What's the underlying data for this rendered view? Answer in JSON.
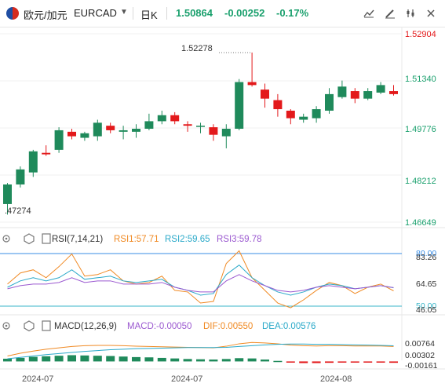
{
  "toolbar": {
    "symbol_cn": "欧元/加元",
    "symbol": "EURCAD",
    "period": "日K",
    "price": "1.50864",
    "change": "-0.00252",
    "change_pct": "-0.17%",
    "quote_color": "#1aa06d",
    "icons": [
      "chart-style-icon",
      "draw-icon",
      "settings-icon",
      "indicator-icon"
    ]
  },
  "main_chart": {
    "price_labels": [
      "1.52904",
      "1.51340",
      "1.49776",
      "1.48212",
      "1.46649"
    ],
    "high_label": "1.52278",
    "low_label": ".47274",
    "last_price_label": "1.51340",
    "up_color": "#1f8a5b",
    "down_color": "#e3191b",
    "price_label_color": "#e3191b",
    "price_label_color_2": "#1aa06d"
  },
  "rsi": {
    "title": "RSI(7,14,21)",
    "rsi1": "RSI1:57.71",
    "rsi2": "RSI2:59.65",
    "rsi3": "RSI3:59.78",
    "rsi1_color": "#f08a24",
    "rsi2_color": "#2aa9c9",
    "rsi3_color": "#9b59d0",
    "axis_labels": [
      "80.00",
      "83.26",
      "64.65",
      "50.00",
      "46.05"
    ]
  },
  "macd": {
    "title": "MACD(12,26,9)",
    "macd": "MACD:-0.00050",
    "dif": "DIF:0.00550",
    "dea": "DEA:0.00576",
    "macd_color": "#9b59d0",
    "dif_color": "#f08a24",
    "dea_color": "#2aa9c9",
    "axis_labels": [
      "0.00764",
      "0.00302",
      "-0.00161"
    ]
  },
  "x_axis": [
    "2024-07",
    "2024-07",
    "2024-08"
  ],
  "chart_data": [
    {
      "type": "candlestick",
      "title": "",
      "ylim": [
        1.46649,
        1.52904
      ],
      "candles": [
        {
          "o": 1.4725,
          "h": 1.4795,
          "l": 1.469,
          "c": 1.479
        },
        {
          "o": 1.479,
          "h": 1.485,
          "l": 1.478,
          "c": 1.484
        },
        {
          "o": 1.483,
          "h": 1.4905,
          "l": 1.4815,
          "c": 1.49
        },
        {
          "o": 1.4895,
          "h": 1.492,
          "l": 1.4885,
          "c": 1.489
        },
        {
          "o": 1.4905,
          "h": 1.498,
          "l": 1.4895,
          "c": 1.497
        },
        {
          "o": 1.4965,
          "h": 1.4975,
          "l": 1.494,
          "c": 1.495
        },
        {
          "o": 1.4945,
          "h": 1.4965,
          "l": 1.4935,
          "c": 1.496
        },
        {
          "o": 1.495,
          "h": 1.5005,
          "l": 1.4935,
          "c": 1.4995
        },
        {
          "o": 1.4985,
          "h": 1.4995,
          "l": 1.496,
          "c": 1.497
        },
        {
          "o": 1.4965,
          "h": 1.4985,
          "l": 1.494,
          "c": 1.497
        },
        {
          "o": 1.4965,
          "h": 1.499,
          "l": 1.4945,
          "c": 1.4975
        },
        {
          "o": 1.4975,
          "h": 1.5025,
          "l": 1.497,
          "c": 1.5
        },
        {
          "o": 1.5,
          "h": 1.5035,
          "l": 1.499,
          "c": 1.502
        },
        {
          "o": 1.502,
          "h": 1.503,
          "l": 1.499,
          "c": 1.5
        },
        {
          "o": 1.499,
          "h": 1.5,
          "l": 1.4965,
          "c": 1.4985
        },
        {
          "o": 1.4985,
          "h": 1.4995,
          "l": 1.496,
          "c": 1.4985
        },
        {
          "o": 1.498,
          "h": 1.499,
          "l": 1.4935,
          "c": 1.4955
        },
        {
          "o": 1.495,
          "h": 1.499,
          "l": 1.491,
          "c": 1.4975
        },
        {
          "o": 1.4975,
          "h": 1.514,
          "l": 1.497,
          "c": 1.513
        },
        {
          "o": 1.513,
          "h": 1.5228,
          "l": 1.5115,
          "c": 1.512
        },
        {
          "o": 1.5105,
          "h": 1.5125,
          "l": 1.5045,
          "c": 1.5075
        },
        {
          "o": 1.507,
          "h": 1.509,
          "l": 1.5015,
          "c": 1.504
        },
        {
          "o": 1.5035,
          "h": 1.504,
          "l": 1.499,
          "c": 1.501
        },
        {
          "o": 1.5005,
          "h": 1.5025,
          "l": 1.4995,
          "c": 1.5015
        },
        {
          "o": 1.501,
          "h": 1.505,
          "l": 1.4995,
          "c": 1.504
        },
        {
          "o": 1.5035,
          "h": 1.511,
          "l": 1.5025,
          "c": 1.509
        },
        {
          "o": 1.508,
          "h": 1.5135,
          "l": 1.5075,
          "c": 1.5115
        },
        {
          "o": 1.51,
          "h": 1.511,
          "l": 1.506,
          "c": 1.5075
        },
        {
          "o": 1.5075,
          "h": 1.511,
          "l": 1.507,
          "c": 1.51
        },
        {
          "o": 1.5095,
          "h": 1.513,
          "l": 1.509,
          "c": 1.512
        },
        {
          "o": 1.51,
          "h": 1.512,
          "l": 1.5085,
          "c": 1.509
        }
      ]
    },
    {
      "type": "line",
      "title": "RSI(7,14,21)",
      "ylim": [
        46.05,
        83.26
      ],
      "series": [
        {
          "name": "RSI1",
          "values": [
            62,
            69,
            71,
            66,
            73,
            81,
            67,
            68,
            71,
            64,
            62,
            63,
            67,
            58,
            57,
            50,
            51,
            75,
            83,
            66,
            58,
            50,
            47,
            52,
            58,
            63,
            61,
            56,
            60,
            62,
            57.71
          ]
        },
        {
          "name": "RSI2",
          "values": [
            60,
            64,
            66,
            64,
            66,
            71,
            65,
            66,
            67,
            64,
            63,
            64,
            65,
            60,
            58,
            55,
            56,
            68,
            74,
            66,
            61,
            57,
            55,
            57,
            60,
            62,
            61,
            59,
            60,
            61,
            59.65
          ]
        },
        {
          "name": "RSI3",
          "values": [
            59,
            61,
            62,
            62,
            63,
            66,
            63,
            64,
            64,
            62,
            62,
            62,
            63,
            60,
            58,
            57,
            57,
            64,
            68,
            64,
            61,
            58,
            57,
            58,
            60,
            61,
            60,
            59,
            60,
            61,
            59.78
          ]
        }
      ]
    },
    {
      "type": "bar",
      "title": "MACD(12,26,9)",
      "ylim": [
        -0.00161,
        0.00764
      ],
      "series": [
        {
          "name": "MACD",
          "values": [
            0.001,
            0.0013,
            0.0017,
            0.0019,
            0.0021,
            0.0023,
            0.0022,
            0.0021,
            0.002,
            0.0018,
            0.0016,
            0.0015,
            0.0013,
            0.0011,
            0.0009,
            0.0008,
            0.0007,
            0.0009,
            0.0012,
            0.0011,
            0.0007,
            0.0002,
            -0.0004,
            -0.0006,
            -0.0006,
            -0.0005,
            -0.0004,
            -0.0004,
            -0.0004,
            -0.0004,
            -0.0005
          ]
        },
        {
          "name": "DIF",
          "values": [
            0.002,
            0.003,
            0.0038,
            0.0045,
            0.005,
            0.0055,
            0.0058,
            0.0059,
            0.0059,
            0.0058,
            0.0056,
            0.0055,
            0.0054,
            0.0053,
            0.0052,
            0.0051,
            0.005,
            0.0056,
            0.0065,
            0.007,
            0.0068,
            0.0065,
            0.006,
            0.0058,
            0.0057,
            0.0058,
            0.0058,
            0.0057,
            0.0057,
            0.0057,
            0.0055
          ]
        },
        {
          "name": "DEA",
          "values": [
            0.001,
            0.0015,
            0.002,
            0.0025,
            0.0029,
            0.0033,
            0.0037,
            0.004,
            0.0043,
            0.0045,
            0.0047,
            0.0048,
            0.0049,
            0.005,
            0.0051,
            0.0051,
            0.0051,
            0.0052,
            0.0055,
            0.0058,
            0.0061,
            0.0063,
            0.0064,
            0.0064,
            0.0063,
            0.0063,
            0.0062,
            0.0061,
            0.006,
            0.0059,
            0.00576
          ]
        }
      ]
    }
  ]
}
